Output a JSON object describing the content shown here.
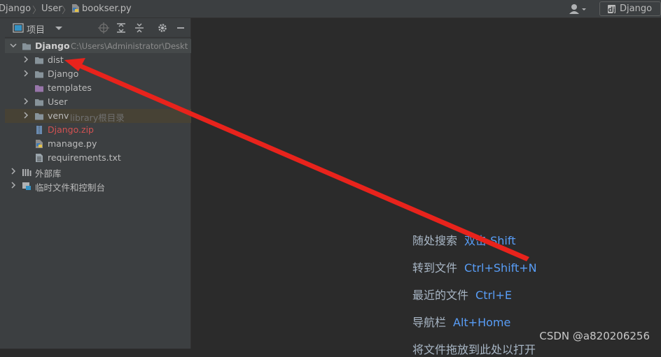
{
  "breadcrumbs": [
    "Django",
    "User",
    "bookser.py"
  ],
  "run_config": {
    "label": "Django"
  },
  "project_panel": {
    "title": "项目",
    "tree": [
      {
        "label": "Django",
        "path": "C:\\Users\\Administrator\\Deskt",
        "expanded": true
      },
      {
        "label": "dist"
      },
      {
        "label": "Django"
      },
      {
        "label": "templates"
      },
      {
        "label": "User"
      },
      {
        "label": "venv",
        "note": "library根目录"
      },
      {
        "label": "Django.zip"
      },
      {
        "label": "manage.py"
      },
      {
        "label": "requirements.txt"
      },
      {
        "label": "外部库"
      },
      {
        "label": "临时文件和控制台"
      }
    ]
  },
  "editor_hints": [
    {
      "text": "随处搜索",
      "shortcut": "双击 Shift"
    },
    {
      "text": "转到文件",
      "shortcut": "Ctrl+Shift+N"
    },
    {
      "text": "最近的文件",
      "shortcut": "Ctrl+E"
    },
    {
      "text": "导航栏",
      "shortcut": "Alt+Home"
    },
    {
      "text": "将文件拖放到此处以打开",
      "shortcut": ""
    }
  ],
  "watermark": "CSDN @a820206256",
  "colors": {
    "annotation_arrow": "#e8231c",
    "hint_key": "#589df6",
    "error_file": "#d25252"
  }
}
